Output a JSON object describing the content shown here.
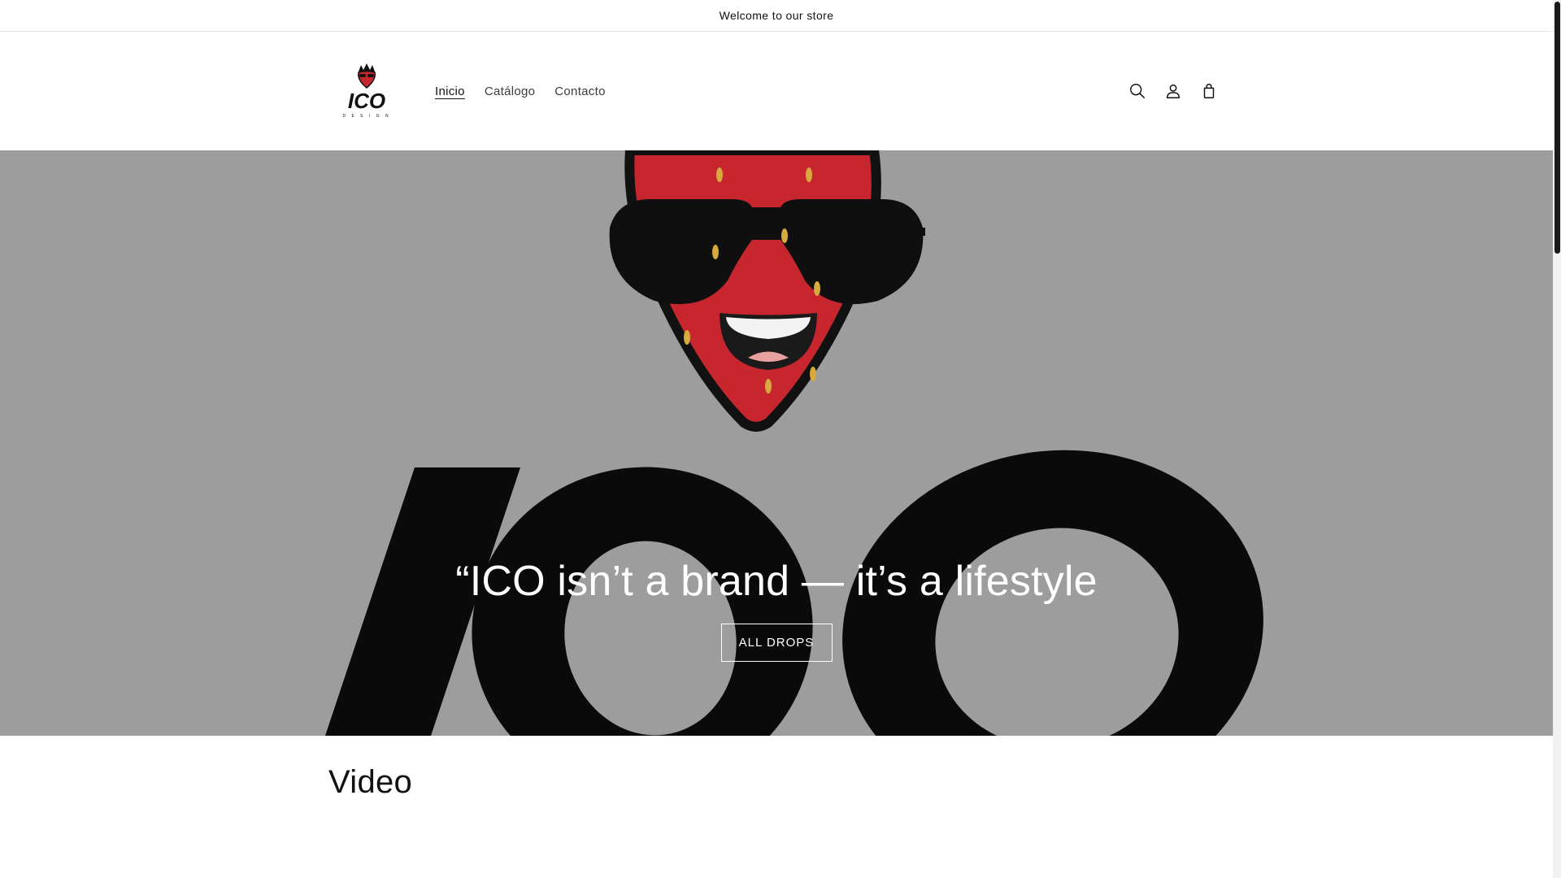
{
  "announcement": {
    "text": "Welcome to our store"
  },
  "header": {
    "logo_text": "ICO",
    "nav": [
      {
        "label": "Inicio",
        "active": true
      },
      {
        "label": "Catálogo",
        "active": false
      },
      {
        "label": "Contacto",
        "active": false
      }
    ],
    "icons": [
      "search-icon",
      "account-icon",
      "cart-icon"
    ]
  },
  "hero": {
    "title": "“ICO isn’t a brand — it’s a lifestyle",
    "button_label": "ALL DROPS",
    "background_color": "#9d9d9d",
    "art_text": "ICO"
  },
  "video_section": {
    "title": "Video"
  },
  "colors": {
    "text": "#121212",
    "accent_red": "#c7262f",
    "background": "#ffffff"
  }
}
